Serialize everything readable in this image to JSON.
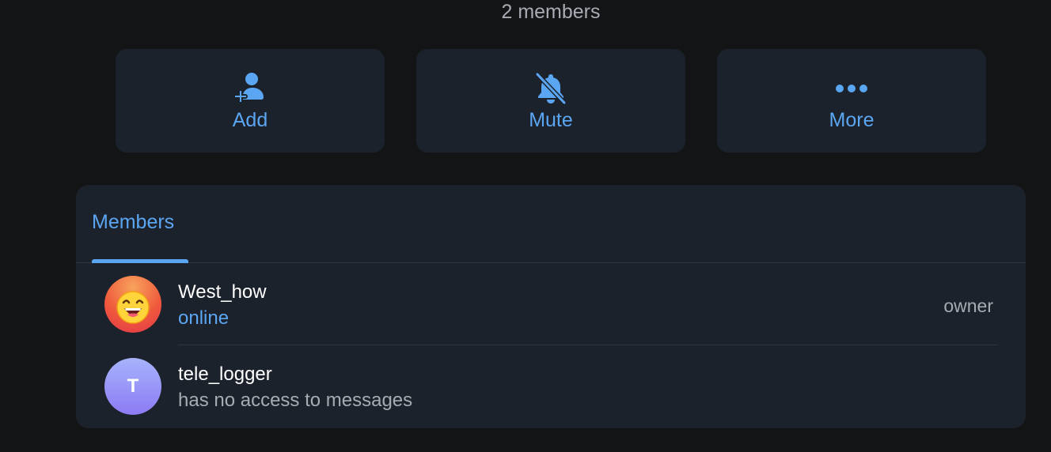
{
  "header": {
    "members_count": "2 members"
  },
  "actions": [
    {
      "label": "Add",
      "icon": "add-member-icon"
    },
    {
      "label": "Mute",
      "icon": "bell-slash-icon"
    },
    {
      "label": "More",
      "icon": "more-dots-icon"
    }
  ],
  "tabs": [
    {
      "label": "Members",
      "active": true
    }
  ],
  "members": [
    {
      "name": "West_how",
      "status": "online",
      "role": "owner",
      "avatar": {
        "type": "emoji",
        "glyph": "😆"
      }
    },
    {
      "name": "tele_logger",
      "status": "has no access to messages",
      "role": "",
      "avatar": {
        "type": "letter",
        "letter": "T"
      }
    }
  ],
  "colors": {
    "background": "#131416",
    "surface": "#1c222b",
    "accent": "#5ba6f3",
    "text_primary": "#ffffff",
    "text_secondary": "#a7abb2"
  }
}
